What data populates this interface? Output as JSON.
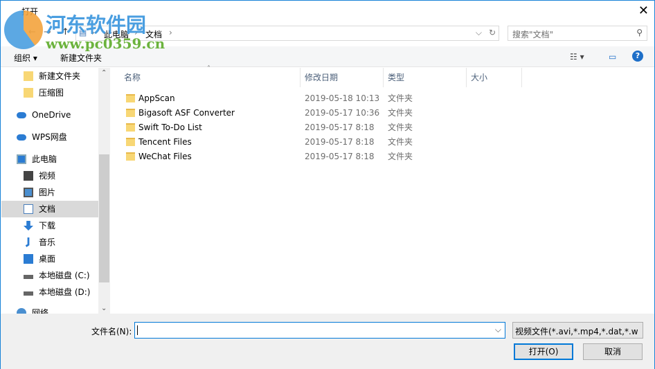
{
  "window": {
    "title": "打开",
    "close": "✕"
  },
  "watermark": {
    "name": "河东软件园",
    "url": "www.pc0359.cn"
  },
  "address": {
    "back": "←",
    "forward": "→",
    "up": "↑",
    "crumbs": [
      "此电脑",
      "文档"
    ],
    "refresh": "↻",
    "dropdown": "⌵"
  },
  "search": {
    "placeholder": "搜索\"文档\"",
    "icon": "⚲"
  },
  "toolbar": {
    "organize": "组织 ▾",
    "new_folder": "新建文件夹",
    "view": "☷ ▾",
    "pane": "▭",
    "help": "?"
  },
  "sidebar": [
    {
      "label": "新建文件夹",
      "icon": "folder-icon"
    },
    {
      "label": "压缩图",
      "icon": "folder-icon"
    },
    {
      "label": "OneDrive",
      "icon": "cloud-icon"
    },
    {
      "label": "WPS网盘",
      "icon": "cloud-icon"
    },
    {
      "label": "此电脑",
      "icon": "computer-icon"
    },
    {
      "label": "视频",
      "icon": "video-icon"
    },
    {
      "label": "图片",
      "icon": "picture-icon"
    },
    {
      "label": "文档",
      "icon": "document-icon"
    },
    {
      "label": "下载",
      "icon": "download-icon"
    },
    {
      "label": "音乐",
      "icon": "music-icon"
    },
    {
      "label": "桌面",
      "icon": "desktop-icon"
    },
    {
      "label": "本地磁盘 (C:)",
      "icon": "drive-icon"
    },
    {
      "label": "本地磁盘 (D:)",
      "icon": "drive-icon"
    },
    {
      "label": "网络",
      "icon": "network-icon"
    }
  ],
  "columns": [
    "名称",
    "修改日期",
    "类型",
    "大小"
  ],
  "files": [
    {
      "name": "AppScan",
      "date": "2019-05-18 10:13",
      "type": "文件夹"
    },
    {
      "name": "Bigasoft ASF Converter",
      "date": "2019-05-17 10:36",
      "type": "文件夹"
    },
    {
      "name": "Swift To-Do List",
      "date": "2019-05-17 8:18",
      "type": "文件夹"
    },
    {
      "name": "Tencent Files",
      "date": "2019-05-17 8:18",
      "type": "文件夹"
    },
    {
      "name": "WeChat Files",
      "date": "2019-05-17 8:18",
      "type": "文件夹"
    }
  ],
  "bottom": {
    "filename_label": "文件名(N):",
    "filename_value": "",
    "filter": "视频文件(*.avi,*.mp4,*.dat,*.w",
    "open": "打开(O)",
    "cancel": "取消"
  }
}
